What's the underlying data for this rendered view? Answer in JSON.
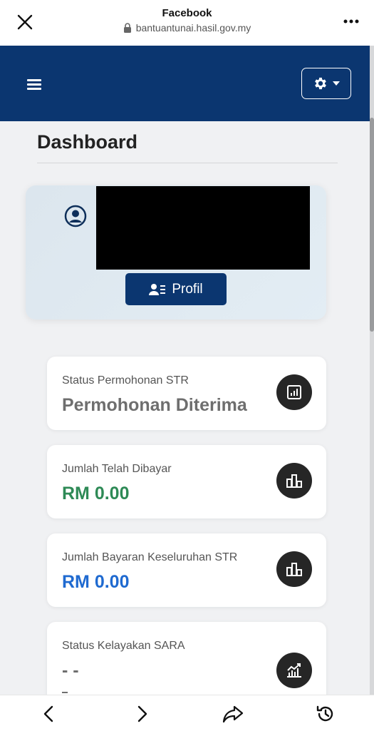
{
  "browser": {
    "title": "Facebook",
    "url": "bantuantunai.hasil.gov.my",
    "icons": {
      "close": "close-icon",
      "lock": "lock-icon",
      "more": "more-icon"
    }
  },
  "header": {
    "brand_color": "#0b3670",
    "icons": {
      "menu": "hamburger-menu-icon",
      "settings": "gear-icon",
      "dropdown": "caret-down-icon"
    }
  },
  "page": {
    "title": "Dashboard"
  },
  "profile": {
    "button_label": "Profil",
    "icons": {
      "avatar": "user-circle-icon",
      "button": "user-details-icon"
    }
  },
  "cards": [
    {
      "label": "Status Permohonan STR",
      "value": "Permohonan Diterima",
      "value_color": "#6e6e6e",
      "icon": "report-icon"
    },
    {
      "label": "Jumlah Telah Dibayar",
      "value": "RM 0.00",
      "value_color": "#2e8a56",
      "icon": "bar-chart-icon"
    },
    {
      "label": "Jumlah Bayaran Keseluruhan STR",
      "value": "RM 0.00",
      "value_color": "#1f6ad0",
      "icon": "bar-chart-icon"
    },
    {
      "label": "Status Kelayakan SARA",
      "value": "- -",
      "value_color": "#6e6e6e",
      "icon": "trend-chart-icon"
    }
  ],
  "bottom_nav": {
    "icons": [
      "back-icon",
      "forward-icon",
      "share-icon",
      "history-icon"
    ]
  }
}
